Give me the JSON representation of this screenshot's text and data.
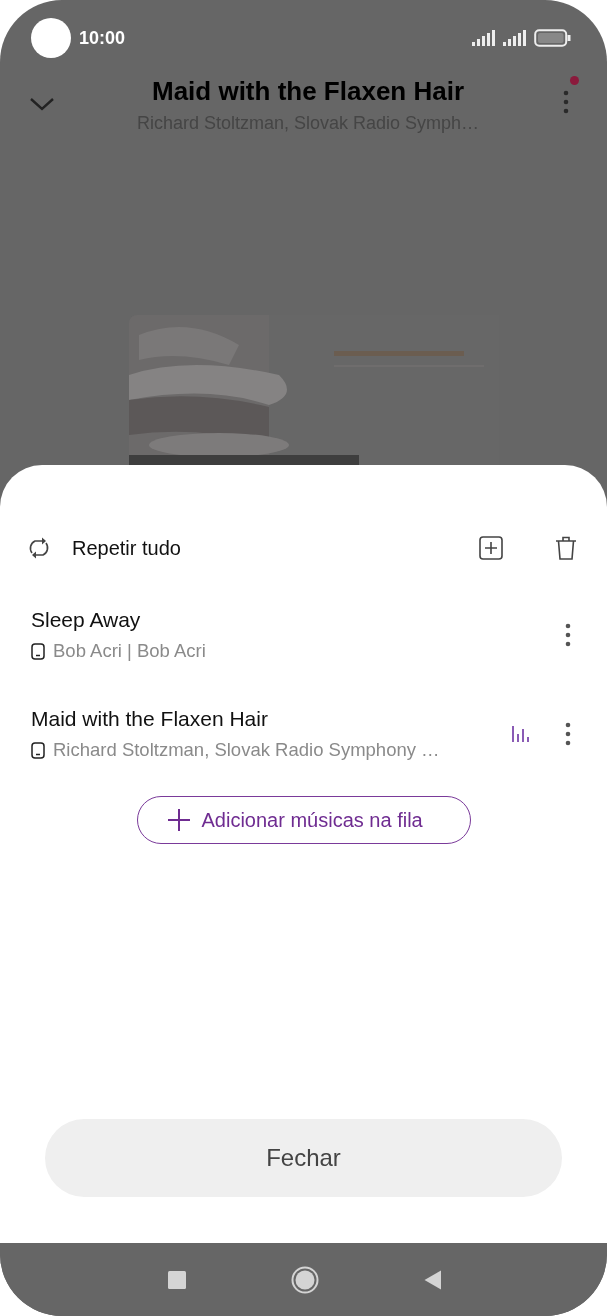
{
  "status_bar": {
    "time": "10:00"
  },
  "header": {
    "title": "Maid with the Flaxen Hair",
    "subtitle": "Richard Stoltzman, Slovak Radio Symph…",
    "notification": true
  },
  "queue": {
    "repeat_label": "Repetir tudo",
    "tracks": [
      {
        "title": "Sleep Away",
        "subtitle": "Bob Acri | Bob Acri",
        "playing": false
      },
      {
        "title": "Maid with the Flaxen Hair",
        "subtitle": "Richard Stoltzman, Slovak Radio Symphony …",
        "playing": true
      }
    ],
    "add_button": "Adicionar músicas na fila",
    "close_button": "Fechar"
  }
}
